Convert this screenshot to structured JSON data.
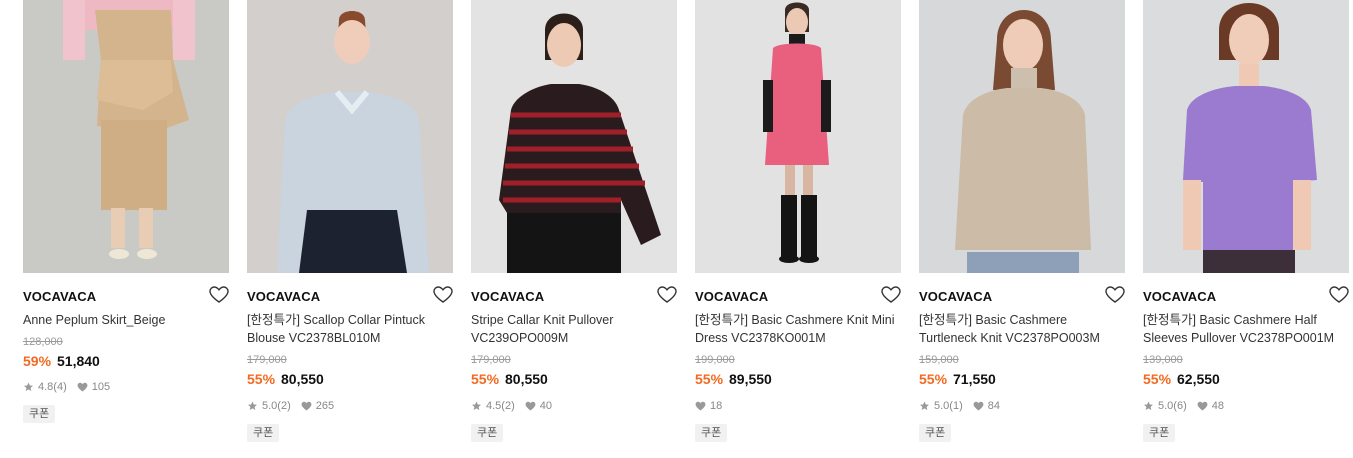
{
  "products": [
    {
      "brand": "VOCAVACA",
      "name": "Anne Peplum Skirt_Beige",
      "original_price": "128,000",
      "discount": "59%",
      "price": "51,840",
      "rating": "4.8",
      "reviews": "(4)",
      "likes": "105",
      "coupon": "쿠폰",
      "image_icon": "beige-peplum-skirt-photo"
    },
    {
      "brand": "VOCAVACA",
      "name": "[한정특가] Scallop Collar Pintuck Blouse VC2378BL010M",
      "original_price": "179,000",
      "discount": "55%",
      "price": "80,550",
      "rating": "5.0",
      "reviews": "(2)",
      "likes": "265",
      "coupon": "쿠폰",
      "image_icon": "light-blue-blouse-photo"
    },
    {
      "brand": "VOCAVACA",
      "name": "Stripe Callar Knit Pullover VC239OPO009M",
      "original_price": "179,000",
      "discount": "55%",
      "price": "80,550",
      "rating": "4.5",
      "reviews": "(2)",
      "likes": "40",
      "coupon": "쿠폰",
      "image_icon": "red-stripe-knit-photo"
    },
    {
      "brand": "VOCAVACA",
      "name": "[한정특가] Basic Cashmere Knit Mini Dress VC2378KO001M",
      "original_price": "199,000",
      "discount": "55%",
      "price": "89,550",
      "likes": "18",
      "coupon": "쿠폰",
      "image_icon": "pink-knit-dress-photo"
    },
    {
      "brand": "VOCAVACA",
      "name": "[한정특가] Basic Cashmere Turtleneck Knit VC2378PO003M",
      "original_price": "159,000",
      "discount": "55%",
      "price": "71,550",
      "rating": "5.0",
      "reviews": "(1)",
      "likes": "84",
      "coupon": "쿠폰",
      "image_icon": "beige-turtleneck-photo"
    },
    {
      "brand": "VOCAVACA",
      "name": "[한정특가] Basic Cashmere Half Sleeves Pullover VC2378PO001M",
      "original_price": "139,000",
      "discount": "55%",
      "price": "62,550",
      "rating": "5.0",
      "reviews": "(6)",
      "likes": "48",
      "coupon": "쿠폰",
      "image_icon": "purple-half-sleeve-knit-photo"
    }
  ],
  "colors": {
    "discount": "#f26a21",
    "strikethrough": "#9a9a9a",
    "coupon_bg": "#f1f1f1"
  }
}
